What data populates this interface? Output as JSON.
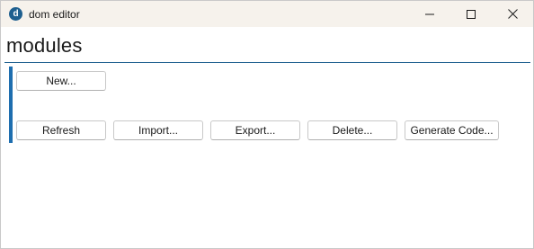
{
  "window": {
    "title": "dom editor",
    "app_icon_letter": "d"
  },
  "page": {
    "title": "modules"
  },
  "buttons": {
    "new": "New...",
    "refresh": "Refresh",
    "import": "Import...",
    "export": "Export...",
    "delete": "Delete...",
    "generate_code": "Generate Code..."
  },
  "colors": {
    "accent": "#1e6eaf",
    "titlebar": "#f6f2ec"
  }
}
